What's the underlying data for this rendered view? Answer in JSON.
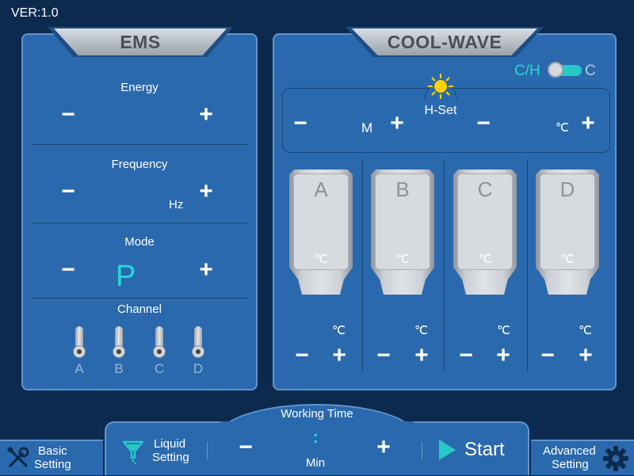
{
  "version": "VER:1.0",
  "ems": {
    "title": "EMS",
    "energy_label": "Energy",
    "frequency_label": "Frequency",
    "frequency_unit": "Hz",
    "mode_label": "Mode",
    "mode_value": "P",
    "channel_label": "Channel",
    "channels": [
      "A",
      "B",
      "C",
      "D"
    ]
  },
  "cool_wave": {
    "title": "COOL-WAVE",
    "ch_label": "C/H",
    "ch_state": "C",
    "hset_label": "H-Set",
    "hset_time_unit": "M",
    "hset_temp_unit": "℃",
    "handles": [
      {
        "letter": "A",
        "unit": "℃"
      },
      {
        "letter": "B",
        "unit": "℃"
      },
      {
        "letter": "C",
        "unit": "℃"
      },
      {
        "letter": "D",
        "unit": "℃"
      }
    ]
  },
  "controls": {
    "minus": "−",
    "plus": "+"
  },
  "bottom": {
    "working_time_label": "Working Time",
    "time_colon": ":",
    "time_unit": "Min",
    "liquid_setting": [
      "Liquid",
      "Setting"
    ],
    "start_label": "Start",
    "basic_setting": [
      "Basic",
      "Setting"
    ],
    "advanced_setting": [
      "Advanced",
      "Setting"
    ]
  },
  "colors": {
    "panel": "#2a69ad",
    "background": "#0c2a4e",
    "accent": "#27c9c7",
    "border": "#5f95cf"
  }
}
